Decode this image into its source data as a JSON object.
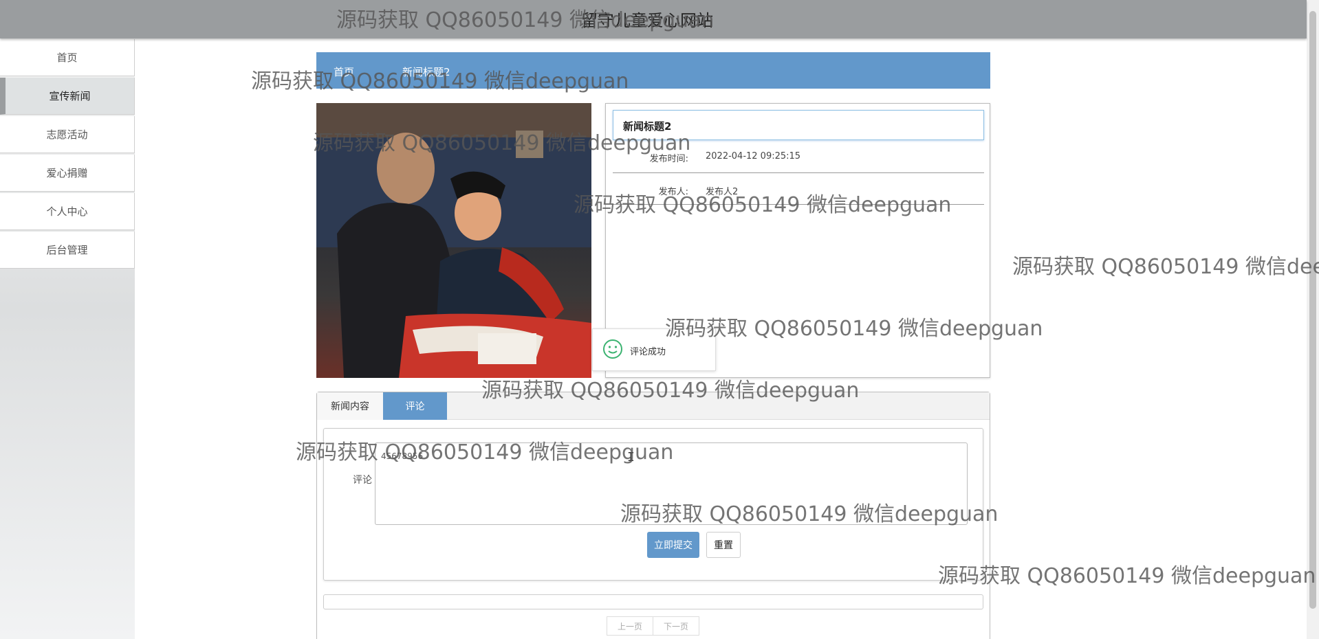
{
  "header": {
    "site_title": "留守儿童爱心网站"
  },
  "sidebar": {
    "items": [
      {
        "label": "首页"
      },
      {
        "label": "宣传新闻"
      },
      {
        "label": "志愿活动"
      },
      {
        "label": "爱心捐赠"
      },
      {
        "label": "个人中心"
      },
      {
        "label": "后台管理"
      }
    ],
    "active_index": 1
  },
  "breadcrumb": {
    "home": "首页",
    "current": "新闻标题2"
  },
  "news": {
    "title": "新闻标题2",
    "publish_time_label": "发布时间:",
    "publish_time": "2022-04-12 09:25:15",
    "publisher_label": "发布人:",
    "publisher": "发布人2"
  },
  "toast": {
    "message": "评论成功",
    "icon": "smile-icon"
  },
  "tabs": [
    {
      "label": "新闻内容"
    },
    {
      "label": "评论"
    }
  ],
  "comment_form": {
    "label": "评论",
    "value": "45678956",
    "submit_label": "立即提交",
    "reset_label": "重置"
  },
  "pager": {
    "prev": "上一页",
    "next": "下一页"
  },
  "watermark": "源码获取 QQ86050149 微信deepguan",
  "colors": {
    "accent": "#6298cb",
    "topbar": "#9a9d9f"
  }
}
